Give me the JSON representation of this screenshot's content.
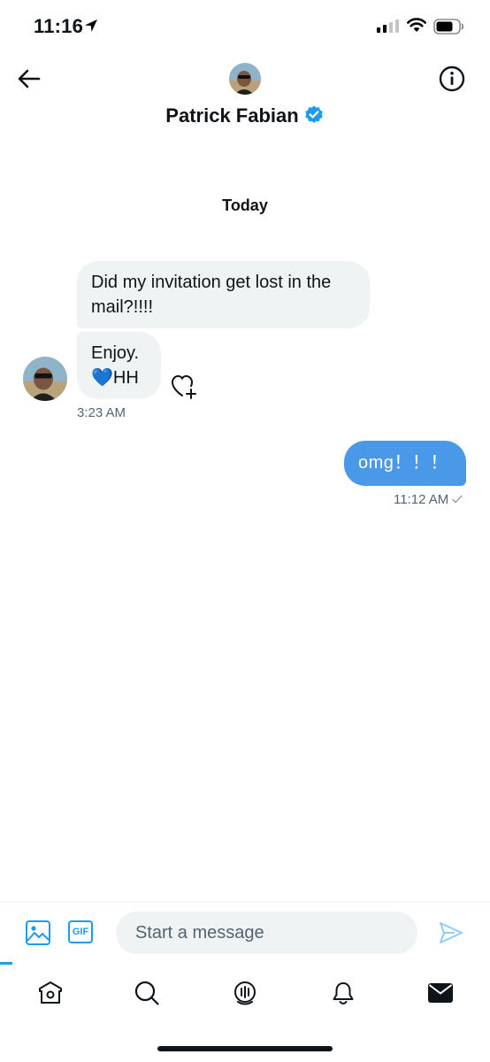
{
  "status_bar": {
    "time": "11:16",
    "icons": [
      "location-arrow-icon",
      "cellular-signal-icon",
      "wifi-icon",
      "battery-icon"
    ]
  },
  "header": {
    "back_icon": "arrow-left-icon",
    "name": "Patrick Fabian",
    "verified": true,
    "info_icon": "info-circle-icon"
  },
  "conversation": {
    "date_divider": "Today",
    "incoming": [
      {
        "text_line1": "Did my invitation get lost in the",
        "text_line2": "mail?!!!!"
      },
      {
        "text_line1": "Enjoy.",
        "emoji": "💙",
        "text_line2": "HH"
      }
    ],
    "incoming_time": "3:23 AM",
    "outgoing": [
      {
        "text": "omg！！！"
      }
    ],
    "outgoing_time": "11:12 AM"
  },
  "composer": {
    "gif_label": "GIF",
    "placeholder": "Start a message",
    "value": ""
  },
  "tab_bar": {
    "items": [
      "home-icon",
      "search-icon",
      "spaces-icon",
      "notifications-icon",
      "messages-icon"
    ],
    "active": "messages-icon"
  },
  "colors": {
    "accent": "#1d9bf0",
    "outgoing_bubble": "#4a99e9",
    "incoming_bubble": "#eff3f4",
    "text_primary": "#0f1419",
    "text_secondary": "#536471"
  }
}
